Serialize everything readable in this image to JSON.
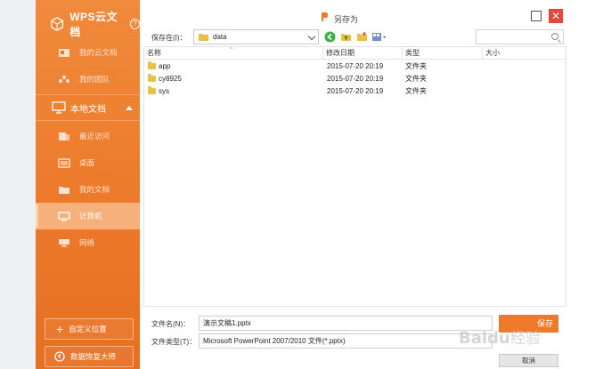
{
  "sidebar": {
    "title": "WPS云文档",
    "help": "?",
    "cloud_items": [
      {
        "label": "我的云文档",
        "icon": "cloud-doc-icon"
      },
      {
        "label": "我的团队",
        "icon": "team-icon"
      }
    ],
    "local_section": {
      "label": "本地文档",
      "icon": "monitor-icon"
    },
    "local_items": [
      {
        "label": "最近访问",
        "icon": "recent-icon"
      },
      {
        "label": "桌面",
        "icon": "desktop-icon"
      },
      {
        "label": "我的文档",
        "icon": "folder-icon"
      },
      {
        "label": "计算机",
        "icon": "computer-icon",
        "selected": true
      },
      {
        "label": "网络",
        "icon": "network-icon"
      }
    ],
    "custom_location_label": "自定义位置",
    "recovery_label": "数据恢复大师"
  },
  "dialog": {
    "title": "另存为",
    "close_glyph": "✕",
    "save_in_label": "保存在(I)：",
    "save_in_value": "data",
    "columns": [
      "名称",
      "修改日期",
      "类型",
      "大小"
    ],
    "files": [
      {
        "name": "app",
        "modified": "2015-07-20 20:19",
        "type": "文件夹",
        "size": ""
      },
      {
        "name": "cy8925",
        "modified": "2015-07-20 20:19",
        "type": "文件夹",
        "size": ""
      },
      {
        "name": "sys",
        "modified": "2015-07-20 20:19",
        "type": "文件夹",
        "size": ""
      }
    ],
    "filename_label": "文件名(N)：",
    "filename_value": "演示文稿1.pptx",
    "filetype_label": "文件类型(T)：",
    "filetype_value": "Microsoft PowerPoint 2007/2010 文件(*.pptx)",
    "save_button": "保存",
    "cancel_button": "取消"
  },
  "watermark": "Baidu 经验",
  "colors": {
    "accent": "#ec7a2a",
    "close": "#e8463c",
    "folder": "#e8c04a"
  }
}
